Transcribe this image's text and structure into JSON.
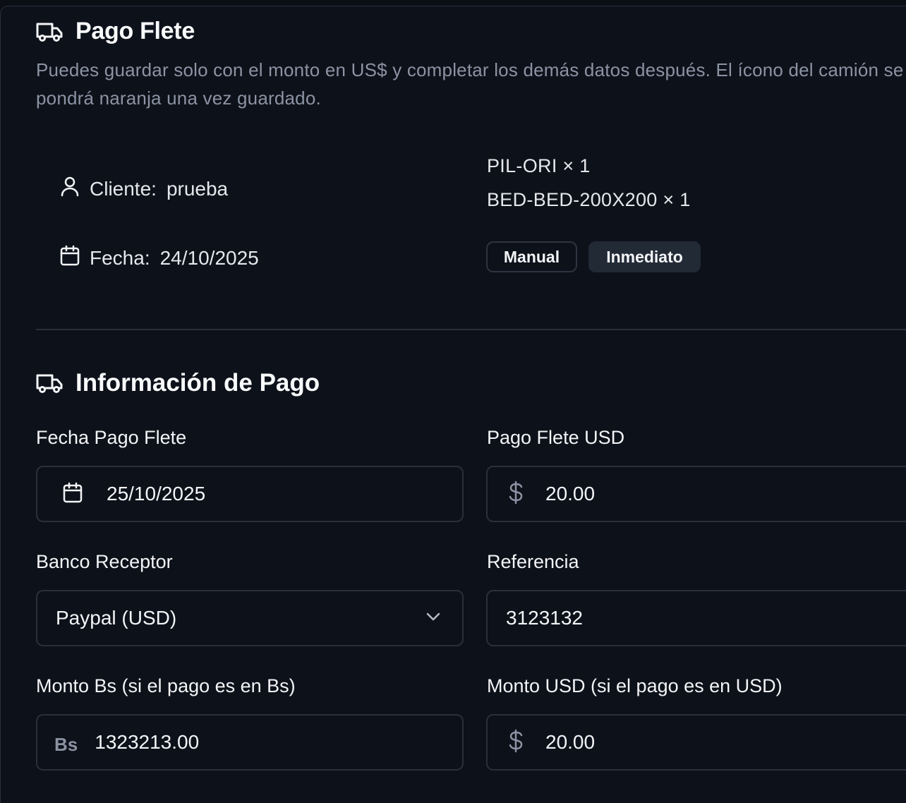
{
  "header": {
    "title": "Pago Flete",
    "subtitle": "Puedes guardar solo con el monto en US$ y completar los demás datos después. El ícono del camión se pondrá naranja una vez guardado."
  },
  "summary": {
    "cliente_label": "Cliente:",
    "cliente_value": "prueba",
    "fecha_label": "Fecha:",
    "fecha_value": "24/10/2025",
    "products": [
      "PIL-ORI × 1",
      "BED-BED-200X200 × 1"
    ],
    "badges": [
      "Manual",
      "Inmediato"
    ]
  },
  "payment": {
    "section_title": "Información de Pago",
    "fecha_pago_label": "Fecha Pago Flete",
    "fecha_pago_value": "25/10/2025",
    "pago_flete_usd_label": "Pago Flete USD",
    "pago_flete_usd_value": "20.00",
    "banco_label": "Banco Receptor",
    "banco_value": "Paypal (USD)",
    "referencia_label": "Referencia",
    "referencia_value": "3123132",
    "monto_bs_label": "Monto Bs (si el pago es en Bs)",
    "monto_bs_prefix": "Bs",
    "monto_bs_value": "1323213.00",
    "monto_usd_label": "Monto USD (si el pago es en USD)",
    "monto_usd_value": "20.00"
  },
  "icons": {
    "truck": "truck-icon",
    "user": "user-icon",
    "calendar": "calendar-icon",
    "dollar": "dollar-icon",
    "chevron": "chevron-down-icon"
  },
  "colors": {
    "background": "#0d111a",
    "border": "#2a2f3a",
    "muted_text": "#8b93a3"
  }
}
